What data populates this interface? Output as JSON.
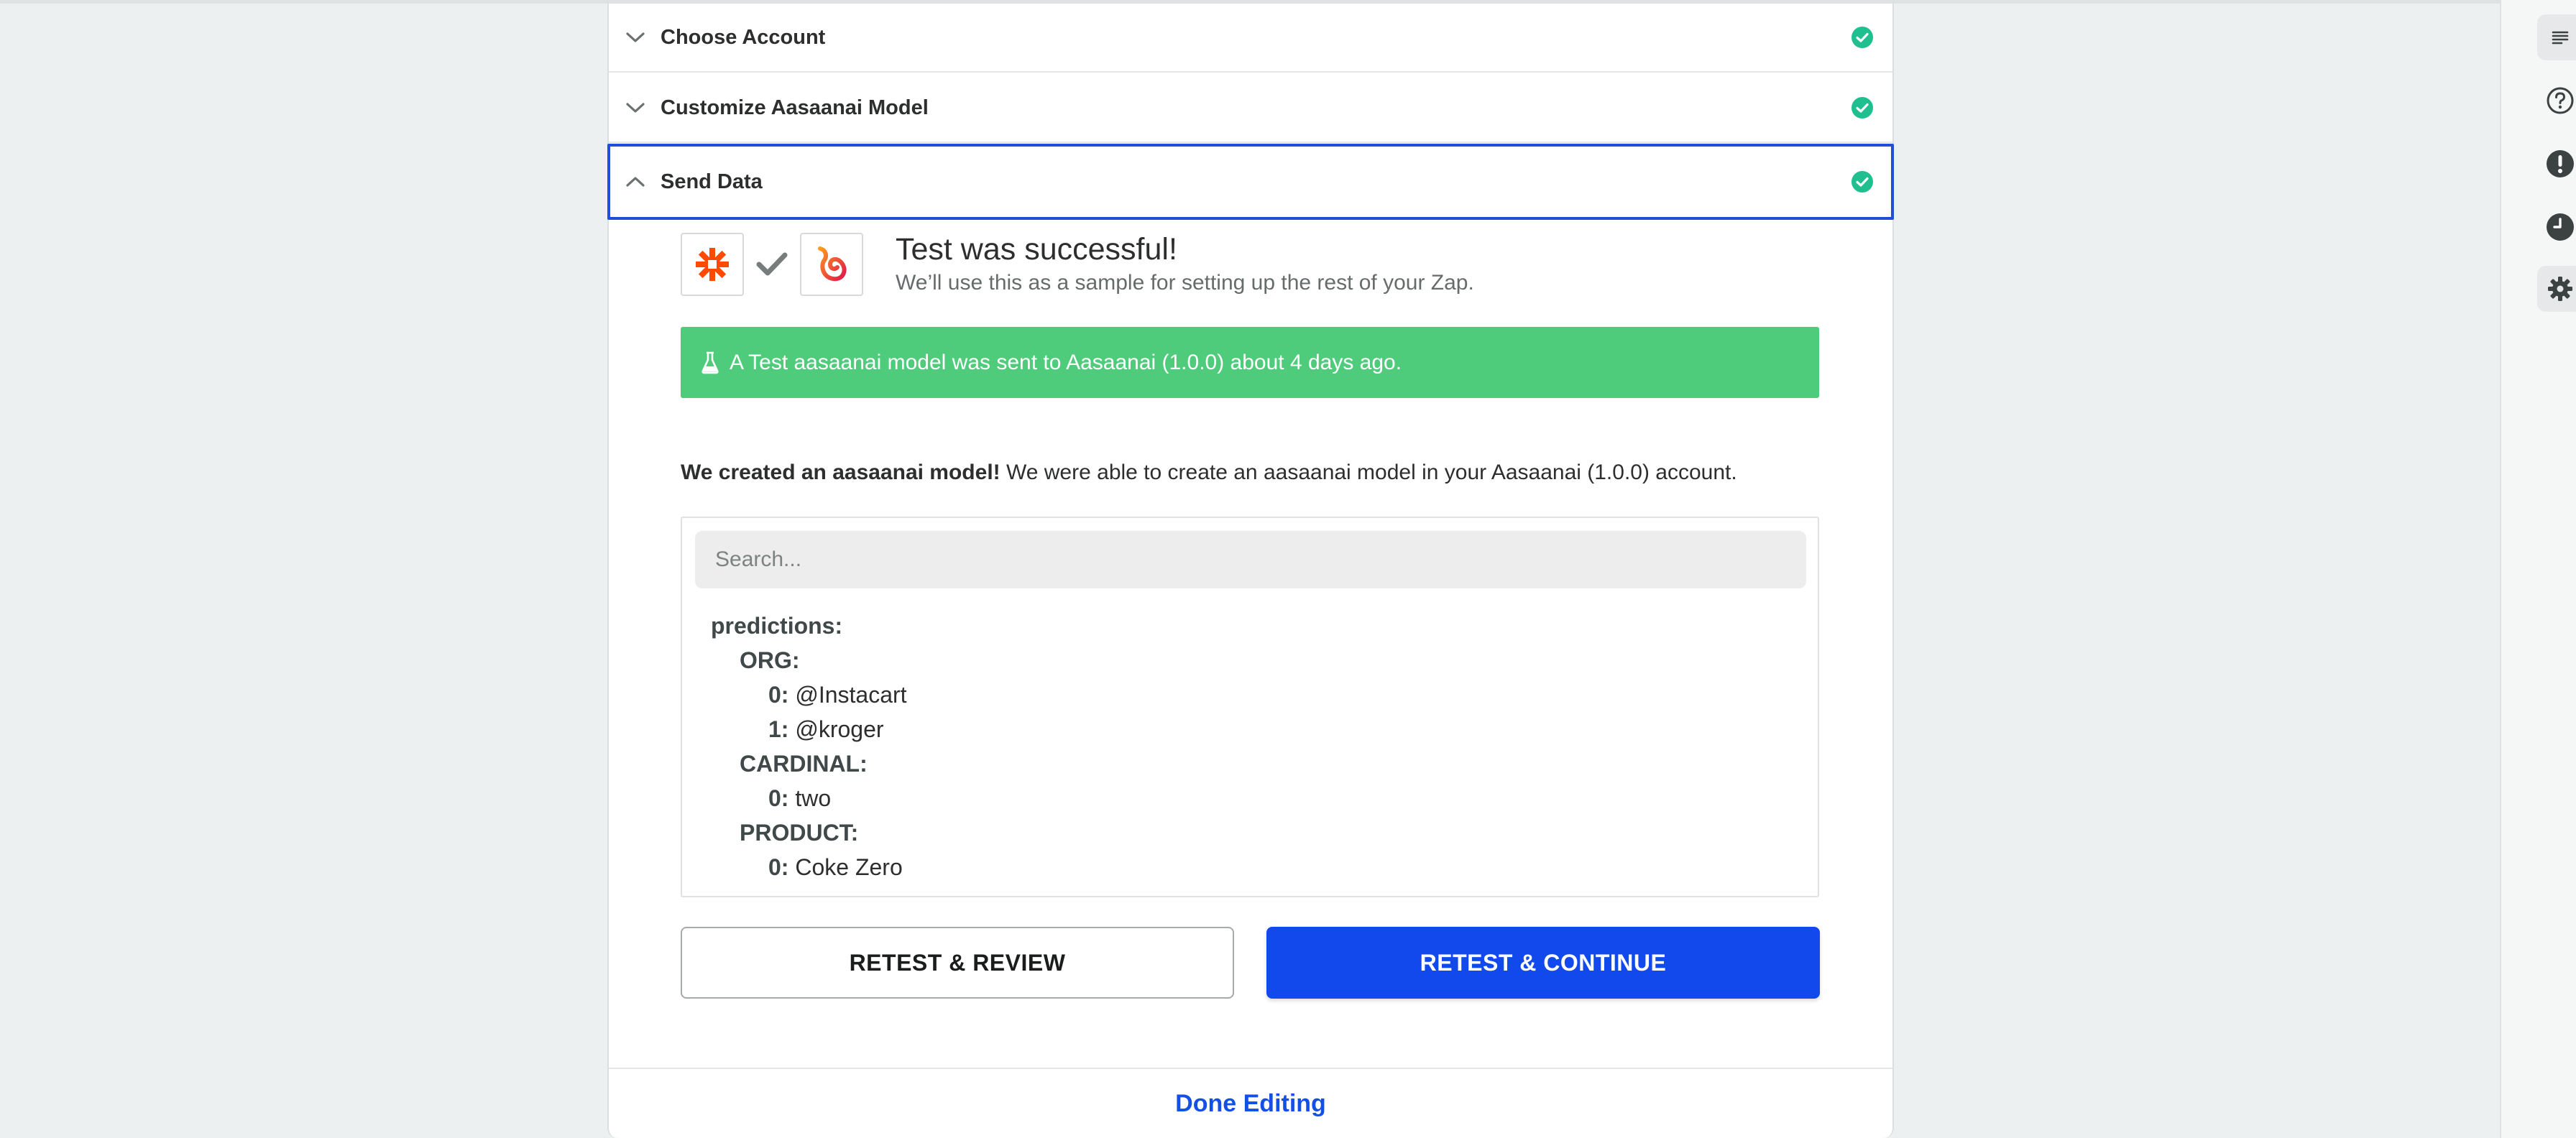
{
  "steps": [
    {
      "title": "Choose Account",
      "expanded": false,
      "complete": true
    },
    {
      "title": "Customize Aasaanai Model",
      "expanded": false,
      "complete": true
    },
    {
      "title": "Send Data",
      "expanded": true,
      "complete": true
    }
  ],
  "result": {
    "title": "Test was successful!",
    "subtitle": "We’ll use this as a sample for setting up the rest of your Zap.",
    "banner": "A Test aasaanai model was sent to Aasaanai (1.0.0) about 4 days ago.",
    "created_bold": "We created an aasaanai model!",
    "created_rest": " We were able to create an aasaanai model in your Aasaanai (1.0.0) account."
  },
  "search": {
    "placeholder": "Search..."
  },
  "tree": {
    "predictions": "predictions:",
    "org": "ORG:",
    "org_0_key": "0:",
    "org_0_val": "@Instacart",
    "org_1_key": "1:",
    "org_1_val": "@kroger",
    "cardinal": "CARDINAL:",
    "cardinal_0_key": "0:",
    "cardinal_0_val": "two",
    "product": "PRODUCT:",
    "product_0_key": "0:",
    "product_0_val": "Coke Zero"
  },
  "buttons": {
    "retest_review": "RETEST & REVIEW",
    "retest_continue": "RETEST & CONTINUE",
    "done": "Done Editing"
  },
  "icons": {
    "apps": [
      "zapier-logo-icon",
      "checkmark-icon",
      "aasaanai-logo-icon"
    ],
    "rail": [
      "list-icon",
      "help-icon",
      "alert-icon",
      "history-icon",
      "gear-icon"
    ]
  },
  "colors": {
    "accent": "#1149ec",
    "success": "#4fcc7b",
    "check": "#1fbf8f",
    "zapier": "#ff4a00",
    "link": "#1550e6"
  }
}
